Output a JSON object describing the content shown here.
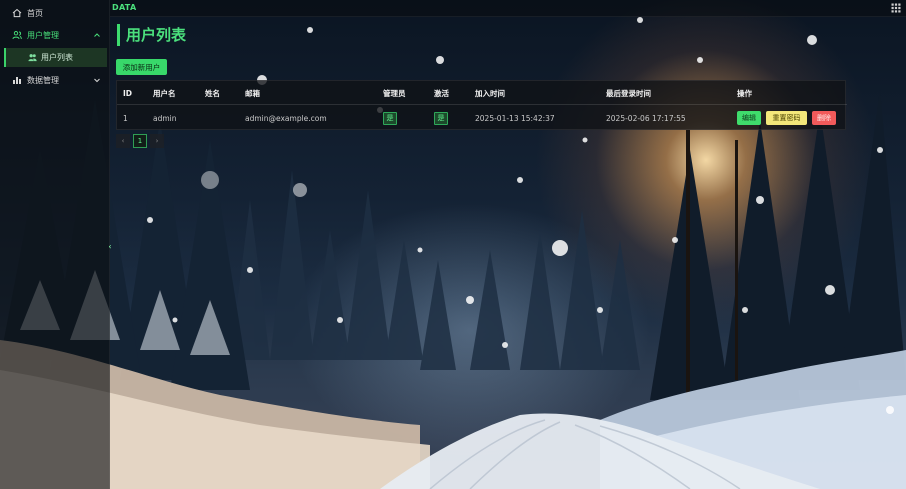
{
  "brand": "DATA",
  "sidebar": {
    "items": [
      {
        "label": "首页",
        "icon": "home-icon"
      },
      {
        "label": "用户管理",
        "icon": "users-icon",
        "expanded": true,
        "children": [
          {
            "label": "用户列表",
            "icon": "user-group-icon",
            "active": true
          }
        ]
      },
      {
        "label": "数据管理",
        "icon": "chart-icon",
        "expanded": false
      }
    ]
  },
  "page": {
    "title": "用户列表",
    "add_button": "添加新用户"
  },
  "table": {
    "columns": [
      "ID",
      "用户名",
      "姓名",
      "邮箱",
      "管理员",
      "激活",
      "加入时间",
      "最后登录时间",
      "操作"
    ],
    "rows": [
      {
        "id": "1",
        "username": "admin",
        "name": "",
        "email": "admin@example.com",
        "is_admin": "是",
        "is_active": "是",
        "joined": "2025-01-13 15:42:37",
        "last_login": "2025-02-06 17:17:55"
      }
    ],
    "actions": {
      "edit": "编辑",
      "reset_password": "重置密码",
      "delete": "删除"
    }
  },
  "pagination": {
    "prev": "‹",
    "current": "1",
    "next": "›"
  },
  "colors": {
    "accent": "#3ddc6f",
    "edit": "#3fdc6c",
    "reset": "#f3e77a",
    "delete": "#f25a5a"
  }
}
